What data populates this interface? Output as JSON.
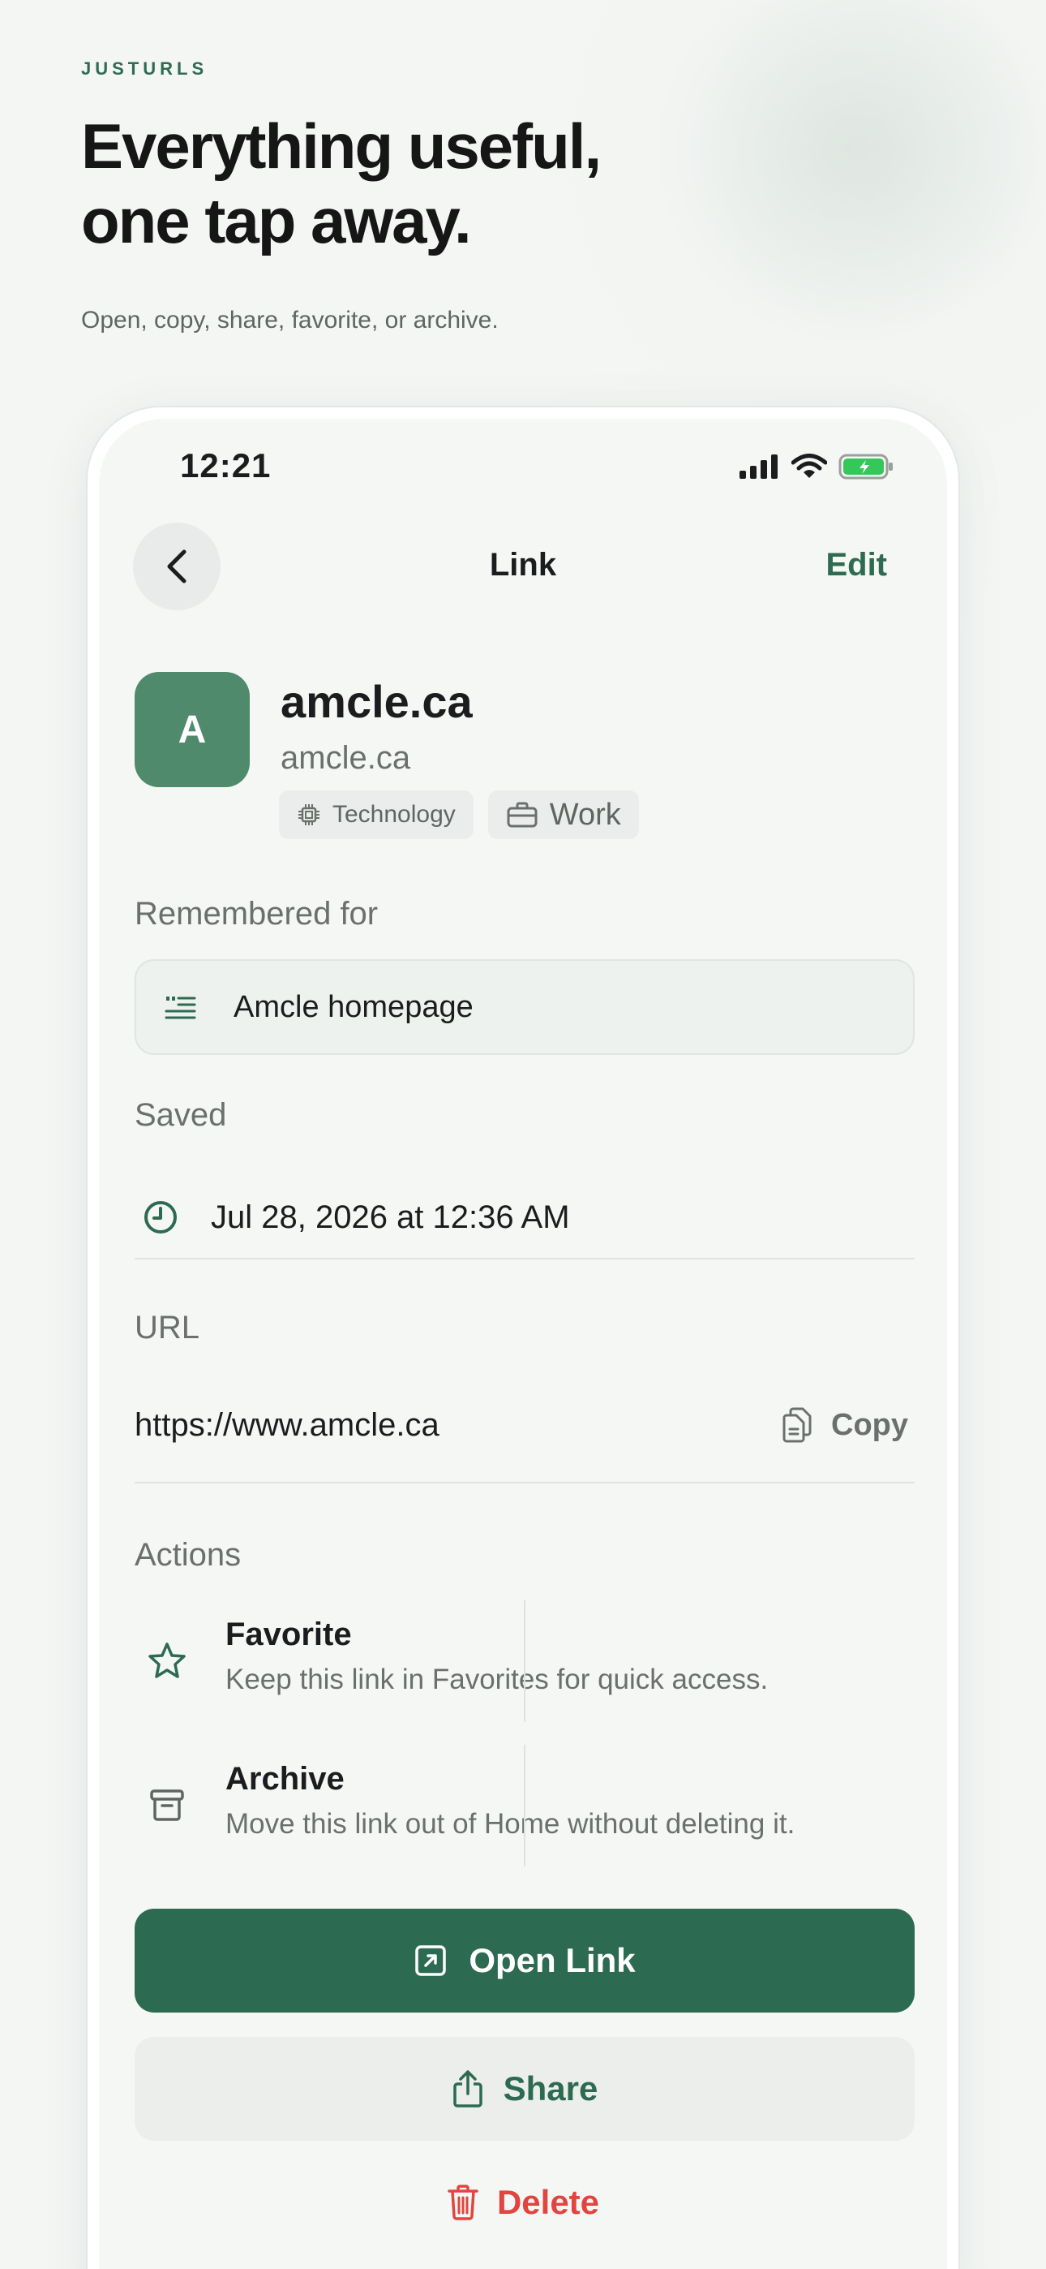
{
  "marketing": {
    "eyebrow": "JUSTURLS",
    "headline": "Everything useful, one tap away.",
    "subline": "Open, copy, share, favorite, or archive."
  },
  "status_bar": {
    "time": "12:21",
    "icons": [
      "cellular-signal-icon",
      "wifi-icon",
      "battery-charging-icon"
    ]
  },
  "nav": {
    "back_icon": "chevron-left-icon",
    "title": "Link",
    "edit_label": "Edit"
  },
  "link": {
    "avatar_letter": "A",
    "title": "amcle.ca",
    "domain": "amcle.ca",
    "tags": [
      {
        "icon": "chip-icon",
        "label": "Technology"
      },
      {
        "icon": "briefcase-icon",
        "label": "Work"
      }
    ]
  },
  "remembered": {
    "label": "Remembered for",
    "icon": "quote-lines-icon",
    "text": "Amcle homepage"
  },
  "saved": {
    "label": "Saved",
    "icon": "clock-icon",
    "value": "Jul 28, 2026 at 12:36 AM"
  },
  "url": {
    "label": "URL",
    "value": "https://www.amcle.ca",
    "copy_label": "Copy",
    "copy_icon": "copy-icon"
  },
  "actions": {
    "label": "Actions",
    "items": [
      {
        "icon": "star-icon",
        "title": "Favorite",
        "description": "Keep this link in Favorites for quick access."
      },
      {
        "icon": "archive-box-icon",
        "title": "Archive",
        "description": "Move this link out of Home without deleting it."
      }
    ]
  },
  "buttons": {
    "open_label": "Open Link",
    "share_label": "Share",
    "delete_label": "Delete"
  },
  "colors": {
    "accent": "#2d6a52",
    "avatar": "#4f8a6d",
    "danger": "#e0463f",
    "battery": "#34c759"
  }
}
